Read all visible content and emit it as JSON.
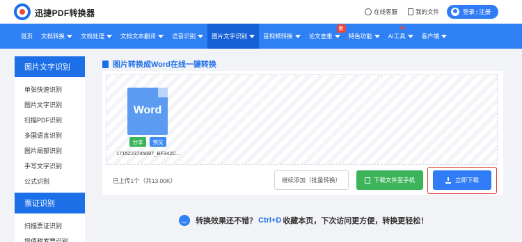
{
  "header": {
    "brand": "迅捷PDF转换器",
    "service": "在线客服",
    "my_files": "我的文件",
    "login": "登录",
    "register": "注册"
  },
  "nav": {
    "items": [
      {
        "label": "首页",
        "arrow": false
      },
      {
        "label": "文档转换",
        "arrow": true
      },
      {
        "label": "文档处理",
        "arrow": true
      },
      {
        "label": "文档文本翻译",
        "arrow": true
      },
      {
        "label": "语音识别",
        "arrow": true
      },
      {
        "label": "图片文字识别",
        "arrow": true,
        "active": true
      },
      {
        "label": "音视频转换",
        "arrow": true
      },
      {
        "label": "论文查重",
        "arrow": true,
        "badge": "新"
      },
      {
        "label": "特色功能",
        "arrow": true
      },
      {
        "label": "AI工具",
        "arrow": true
      },
      {
        "label": "客户端",
        "arrow": true
      }
    ]
  },
  "sidebar": {
    "section1": "图片文字识别",
    "items1": [
      "单张快速识别",
      "图片文字识别",
      "扫描PDF识别",
      "多国语言识别",
      "图片局部识别",
      "手写文字识别",
      "公式识别"
    ],
    "section2": "票证识别",
    "items2": [
      "扫描票证识别",
      "增值税发票识别"
    ]
  },
  "main": {
    "title": "图片转换成Word在线一键转换",
    "file": {
      "type_label": "Word",
      "share": "分享",
      "preview": "预览",
      "name": "1715223745697_BF342C..."
    },
    "uploaded": "已上传1个（共13.00K）",
    "add_button": "继续添加（批量转换）",
    "phone_button": "下载文件至手机",
    "download_button": "立即下载"
  },
  "tip": {
    "text1": "转换效果还不错？",
    "shortcut": "Ctrl+D",
    "text2": "收藏本页，下次访问更方便，转换更轻松！"
  },
  "colors": {
    "brand_blue": "#2f80f4",
    "active_nav": "#1560d6",
    "green": "#3cb45a",
    "highlight_red": "#e33a2f"
  }
}
